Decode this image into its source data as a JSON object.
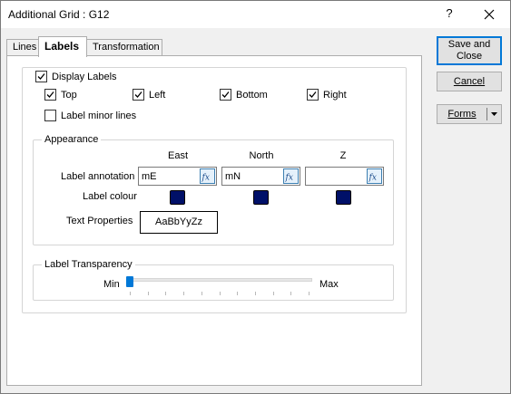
{
  "window": {
    "title": "Additional Grid : G12",
    "help_label": "?"
  },
  "tabs": [
    {
      "label": "Lines",
      "active": false
    },
    {
      "label": "Labels",
      "active": true
    },
    {
      "label": "Transformation",
      "active": false
    }
  ],
  "display_labels": {
    "label": "Display Labels",
    "checked": true
  },
  "sides": [
    {
      "label": "Top",
      "checked": true
    },
    {
      "label": "Left",
      "checked": true
    },
    {
      "label": "Bottom",
      "checked": true
    },
    {
      "label": "Right",
      "checked": true
    }
  ],
  "minor_lines": {
    "label": "Label minor lines",
    "checked": false
  },
  "appearance": {
    "title": "Appearance",
    "columns": [
      "East",
      "North",
      "Z"
    ],
    "annotation_label": "Label annotation",
    "annotations": [
      "mE",
      "mN",
      ""
    ],
    "colour_label": "Label colour",
    "colours": [
      "#001068",
      "#001068",
      "#001068"
    ],
    "text_properties_label": "Text Properties",
    "text_sample": "AaBbYyZz"
  },
  "transparency": {
    "title": "Label Transparency",
    "min_label": "Min",
    "max_label": "Max",
    "value_fraction": 0.0
  },
  "buttons": {
    "save_close": "Save and Close",
    "cancel": "Cancel",
    "forms": "Forms"
  }
}
